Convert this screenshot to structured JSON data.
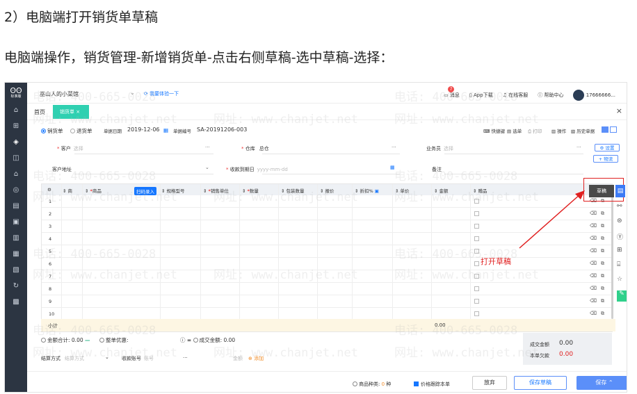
{
  "doc": {
    "step_title": "2）电脑端打开销货单草稿",
    "instruction": "电脑端操作，销货管理-新增销货单-点击右侧草稿-选中草稿-选择："
  },
  "topbar": {
    "company": "巫山人的小菜馆",
    "tour": "我要体验一下",
    "message": "消息",
    "message_badge": "7",
    "app_download": "App下载",
    "online_service": "在线客服",
    "help": "帮助中心",
    "user": "17666666..."
  },
  "sidebar": {
    "logo_text": "标准版"
  },
  "tabs": {
    "home": "首页",
    "active": "销货单",
    "active_close": "×",
    "close_all": "×"
  },
  "form": {
    "type_sales": "销货单",
    "type_return": "退货单",
    "date_label": "单据日期",
    "date_value": "2019-12-06",
    "no_label": "单据编号",
    "no_value": "SA-20191206-003",
    "shortcut": "快捷键",
    "pick": "选单",
    "print": "打印",
    "operate": "操作",
    "history": "历史单据",
    "customer_label": "客户",
    "customer_ph": "选择",
    "warehouse_label": "仓库",
    "warehouse_value": "总仓",
    "salesman_label": "业务员",
    "salesman_ph": "选择",
    "settings_btn": "设置",
    "logistics_btn": "物流",
    "address_label": "客户地址",
    "due_label": "收款到期日",
    "due_ph": "yyyy-mm-dd",
    "remark_label": "备注"
  },
  "table": {
    "headers": [
      "商",
      "商品",
      "扫码录入",
      "规格型号",
      "销售单位",
      "数量",
      "包装数量",
      "报价",
      "折扣%",
      "单价",
      "金额",
      "赠品"
    ],
    "rows": [
      "1",
      "2",
      "3",
      "4",
      "5",
      "6",
      "7",
      "8",
      "9",
      "10"
    ],
    "subtotal_label": "小计",
    "subtotal_amount": "0.00"
  },
  "summary": {
    "total_amount": "金额合计: 0.00",
    "discount": "整单优惠:",
    "deal_amount": "成交金额: 0.00",
    "deal_label": "成交金额",
    "deal_value": "0.00",
    "owe_label": "本单欠款",
    "owe_value": "0.00",
    "settle_label": "结算方式",
    "settle_ph": "结算方式",
    "account_label": "收款账号",
    "account_ph": "账号",
    "amount_label": "金额",
    "add": "添加"
  },
  "footer": {
    "kinds_label": "商品种类:",
    "kinds_value": "0",
    "kinds_unit": "种",
    "track": "价格跟踪本单",
    "giveup": "放弃",
    "save_draft": "保存草稿",
    "save": "保存"
  },
  "draft": {
    "label": "草稿",
    "annotation": "打开草稿"
  },
  "watermark": {
    "phone": "电话: 400-665-0028",
    "site": "网址: www.chanjet.net"
  }
}
